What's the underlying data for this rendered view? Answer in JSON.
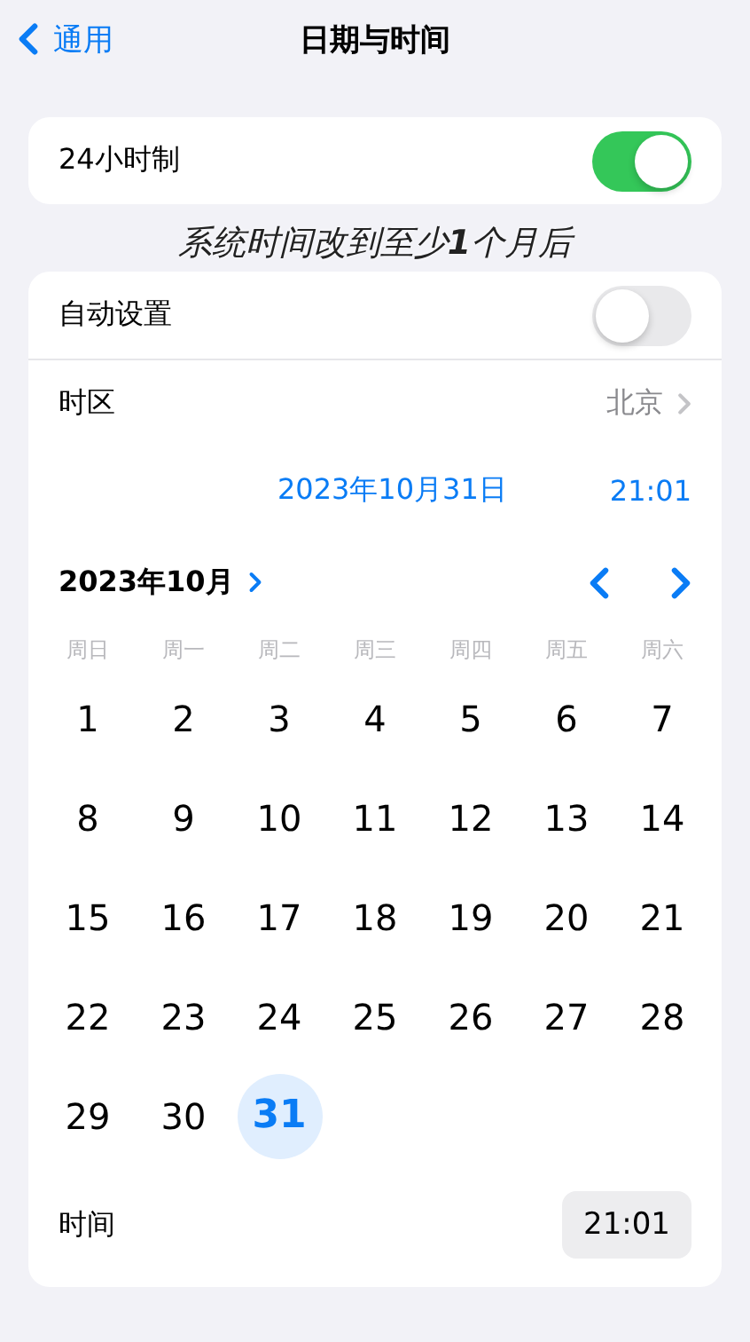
{
  "nav": {
    "back": "通用",
    "title": "日期与时间"
  },
  "hour_format": {
    "label": "24小时制",
    "on": true
  },
  "caption": "系统时间改到至少**1**个月后",
  "settings": {
    "auto": {
      "label": "自动设置",
      "on": false
    },
    "timezone": {
      "label": "时区",
      "value": "北京"
    },
    "selected_date": "2023年10月31日",
    "selected_time": "21:01",
    "calendar": {
      "month": "2023年10月",
      "weekdays": [
        "周日",
        "周一",
        "周二",
        "周三",
        "周四",
        "周五",
        "周六"
      ],
      "days": [
        {
          "label": "1",
          "selected": false
        },
        {
          "label": "2",
          "selected": false
        },
        {
          "label": "3",
          "selected": false
        },
        {
          "label": "4",
          "selected": false
        },
        {
          "label": "5",
          "selected": false
        },
        {
          "label": "6",
          "selected": false
        },
        {
          "label": "7",
          "selected": false
        },
        {
          "label": "8",
          "selected": false
        },
        {
          "label": "9",
          "selected": false
        },
        {
          "label": "10",
          "selected": false
        },
        {
          "label": "11",
          "selected": false
        },
        {
          "label": "12",
          "selected": false
        },
        {
          "label": "13",
          "selected": false
        },
        {
          "label": "14",
          "selected": false
        },
        {
          "label": "15",
          "selected": false
        },
        {
          "label": "16",
          "selected": false
        },
        {
          "label": "17",
          "selected": false
        },
        {
          "label": "18",
          "selected": false
        },
        {
          "label": "19",
          "selected": false
        },
        {
          "label": "20",
          "selected": false
        },
        {
          "label": "21",
          "selected": false
        },
        {
          "label": "22",
          "selected": false
        },
        {
          "label": "23",
          "selected": false
        },
        {
          "label": "24",
          "selected": false
        },
        {
          "label": "25",
          "selected": false
        },
        {
          "label": "26",
          "selected": false
        },
        {
          "label": "27",
          "selected": false
        },
        {
          "label": "28",
          "selected": false
        },
        {
          "label": "29",
          "selected": false
        },
        {
          "label": "30",
          "selected": false
        },
        {
          "label": "31",
          "selected": true
        }
      ]
    },
    "time": {
      "label": "时间",
      "value": "21:01"
    }
  }
}
